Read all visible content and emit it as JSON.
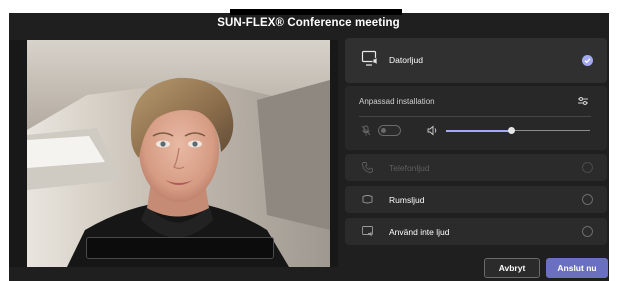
{
  "window": {
    "title": "SUN-FLEX® Conference meeting"
  },
  "audio_options": {
    "computer": {
      "label": "Datorljud",
      "selected": true,
      "icon": "computer-audio-icon"
    },
    "settings": {
      "label": "Anpassad installation",
      "icon": "settings-sliders-icon",
      "mic_muted": true,
      "mic_toggle_on": false,
      "volume_level": 0.45
    },
    "phone": {
      "label": "Telefonljud",
      "selected": false,
      "enabled": false,
      "icon": "phone-audio-icon"
    },
    "room": {
      "label": "Rumsljud",
      "selected": false,
      "icon": "room-audio-icon"
    },
    "none": {
      "label": "Använd inte ljud",
      "selected": false,
      "icon": "no-audio-icon"
    }
  },
  "actions": {
    "cancel": "Avbryt",
    "join": "Anslut nu"
  },
  "colors": {
    "accent": "#6b6fbf",
    "selected_check": "#a3a9f2",
    "window_bg": "#1f1f1f",
    "card_bg": "#2b2b2b"
  }
}
